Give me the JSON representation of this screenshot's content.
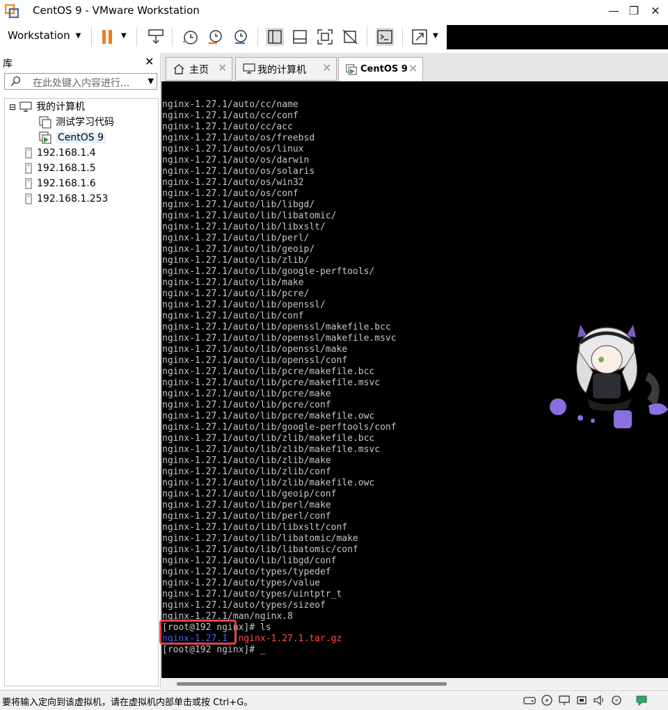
{
  "window": {
    "title": "CentOS 9 - VMware Workstation",
    "minimize_glyph": "—",
    "maximize_glyph": "❐",
    "close_glyph": "✕"
  },
  "toolbar": {
    "workstation_menu": "Workstation",
    "icons": [
      "pause-icon",
      "send-keys-icon",
      "snapshot-icon",
      "revert-snapshot-icon",
      "snapshot-manager-icon",
      "library-view-icon",
      "thumbnail-view-icon",
      "full-screen-icon",
      "unity-icon",
      "console-icon",
      "stretch-icon"
    ]
  },
  "library": {
    "header": "库",
    "close_glyph": "✕",
    "search_placeholder": "在此处键入内容进行...",
    "tree": [
      {
        "label": "我的计算机",
        "expander": "⊟",
        "icon": "computer-icon"
      },
      {
        "label": "测试学习代码",
        "icon": "vm-folder-icon"
      },
      {
        "label": "CentOS 9",
        "icon": "vm-running-icon",
        "selected": true
      },
      {
        "label": "192.168.1.4",
        "icon": "remote-host-icon"
      },
      {
        "label": "192.168.1.5",
        "icon": "remote-host-icon"
      },
      {
        "label": "192.168.1.6",
        "icon": "remote-host-icon"
      },
      {
        "label": "192.168.1.253",
        "icon": "remote-host-icon"
      }
    ]
  },
  "tabs": [
    {
      "label": "主页",
      "icon": "home-icon"
    },
    {
      "label": "我的计算机",
      "icon": "computer-icon"
    },
    {
      "label": "CentOS 9",
      "icon": "vm-running-icon",
      "active": true
    }
  ],
  "tab_close_glyph": "✕",
  "terminal": {
    "lines": [
      "nginx-1.27.1/auto/cc/name",
      "nginx-1.27.1/auto/cc/conf",
      "nginx-1.27.1/auto/cc/acc",
      "nginx-1.27.1/auto/os/freebsd",
      "nginx-1.27.1/auto/os/linux",
      "nginx-1.27.1/auto/os/darwin",
      "nginx-1.27.1/auto/os/solaris",
      "nginx-1.27.1/auto/os/win32",
      "nginx-1.27.1/auto/os/conf",
      "nginx-1.27.1/auto/lib/libgd/",
      "nginx-1.27.1/auto/lib/libatomic/",
      "nginx-1.27.1/auto/lib/libxslt/",
      "nginx-1.27.1/auto/lib/perl/",
      "nginx-1.27.1/auto/lib/geoip/",
      "nginx-1.27.1/auto/lib/zlib/",
      "nginx-1.27.1/auto/lib/google-perftools/",
      "nginx-1.27.1/auto/lib/make",
      "nginx-1.27.1/auto/lib/pcre/",
      "nginx-1.27.1/auto/lib/openssl/",
      "nginx-1.27.1/auto/lib/conf",
      "nginx-1.27.1/auto/lib/openssl/makefile.bcc",
      "nginx-1.27.1/auto/lib/openssl/makefile.msvc",
      "nginx-1.27.1/auto/lib/openssl/make",
      "nginx-1.27.1/auto/lib/openssl/conf",
      "nginx-1.27.1/auto/lib/pcre/makefile.bcc",
      "nginx-1.27.1/auto/lib/pcre/makefile.msvc",
      "nginx-1.27.1/auto/lib/pcre/make",
      "nginx-1.27.1/auto/lib/pcre/conf",
      "nginx-1.27.1/auto/lib/pcre/makefile.owc",
      "nginx-1.27.1/auto/lib/google-perftools/conf",
      "nginx-1.27.1/auto/lib/zlib/makefile.bcc",
      "nginx-1.27.1/auto/lib/zlib/makefile.msvc",
      "nginx-1.27.1/auto/lib/zlib/make",
      "nginx-1.27.1/auto/lib/zlib/conf",
      "nginx-1.27.1/auto/lib/zlib/makefile.owc",
      "nginx-1.27.1/auto/lib/geoip/conf",
      "nginx-1.27.1/auto/lib/perl/make",
      "nginx-1.27.1/auto/lib/perl/conf",
      "nginx-1.27.1/auto/lib/libxslt/conf",
      "nginx-1.27.1/auto/lib/libatomic/make",
      "nginx-1.27.1/auto/lib/libatomic/conf",
      "nginx-1.27.1/auto/lib/libgd/conf",
      "nginx-1.27.1/auto/types/typedef",
      "nginx-1.27.1/auto/types/value",
      "nginx-1.27.1/auto/types/uintptr_t",
      "nginx-1.27.1/auto/types/sizeof",
      "nginx-1.27.1/man/nginx.8"
    ],
    "prompt_ls": "[root@192 nginx]# ls",
    "ls_dir": "nginx-1.27.1",
    "ls_archive": "nginx-1.27.1.tar.gz",
    "prompt_final": "[root@192 nginx]# _",
    "colors": {
      "dir": "#4d5dff",
      "archive": "#ff4d4d",
      "text": "#c8c8c8",
      "highlight_box": "#e04646"
    }
  },
  "status": {
    "text": "要将输入定向到该虚拟机，请在虚拟机内部单击或按 Ctrl+G。",
    "icons": [
      "hard-disk-icon",
      "cd-icon",
      "network-icon",
      "usb-icon",
      "sound-icon",
      "printer-icon",
      "display-icon",
      "message-icon"
    ]
  }
}
